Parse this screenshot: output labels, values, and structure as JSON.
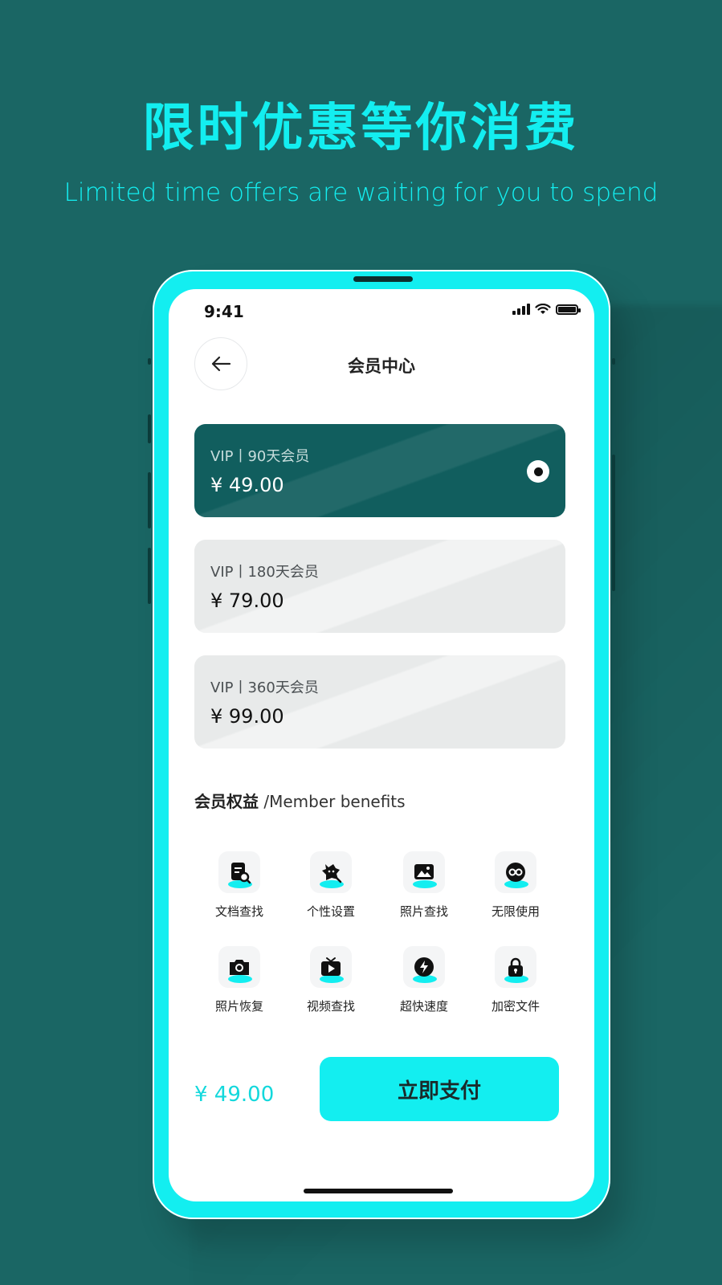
{
  "promo": {
    "title": "限时优惠等你消费",
    "subtitle": "Limited time offers are waiting for you to spend"
  },
  "status_bar": {
    "time": "9:41",
    "icons": [
      "signal-icon",
      "wifi-icon",
      "battery-icon"
    ]
  },
  "header": {
    "back_icon": "back-arrow-icon",
    "title": "会员中心"
  },
  "plans": [
    {
      "label": "VIP丨90天会员",
      "price": "¥ 49.00",
      "selected": true
    },
    {
      "label": "VIP丨180天会员",
      "price": "¥ 79.00",
      "selected": false
    },
    {
      "label": "VIP丨360天会员",
      "price": "¥ 99.00",
      "selected": false
    }
  ],
  "benefits": {
    "heading_cn": "会员权益",
    "heading_en": "/Member benefits",
    "items": [
      {
        "label": "文档查找",
        "icon": "document-search-icon"
      },
      {
        "label": "个性设置",
        "icon": "personalize-icon"
      },
      {
        "label": "照片查找",
        "icon": "photo-search-icon"
      },
      {
        "label": "无限使用",
        "icon": "infinity-icon"
      },
      {
        "label": "照片恢复",
        "icon": "camera-icon"
      },
      {
        "label": "视频查找",
        "icon": "video-icon"
      },
      {
        "label": "超快速度",
        "icon": "lightning-icon"
      },
      {
        "label": "加密文件",
        "icon": "lock-icon"
      }
    ]
  },
  "footer": {
    "total": "¥ 49.00",
    "pay_label": "立即支付"
  },
  "colors": {
    "background": "#1a6664",
    "accent": "#13eef0",
    "selected_card": "#115e5e",
    "card": "#e8eaea"
  }
}
